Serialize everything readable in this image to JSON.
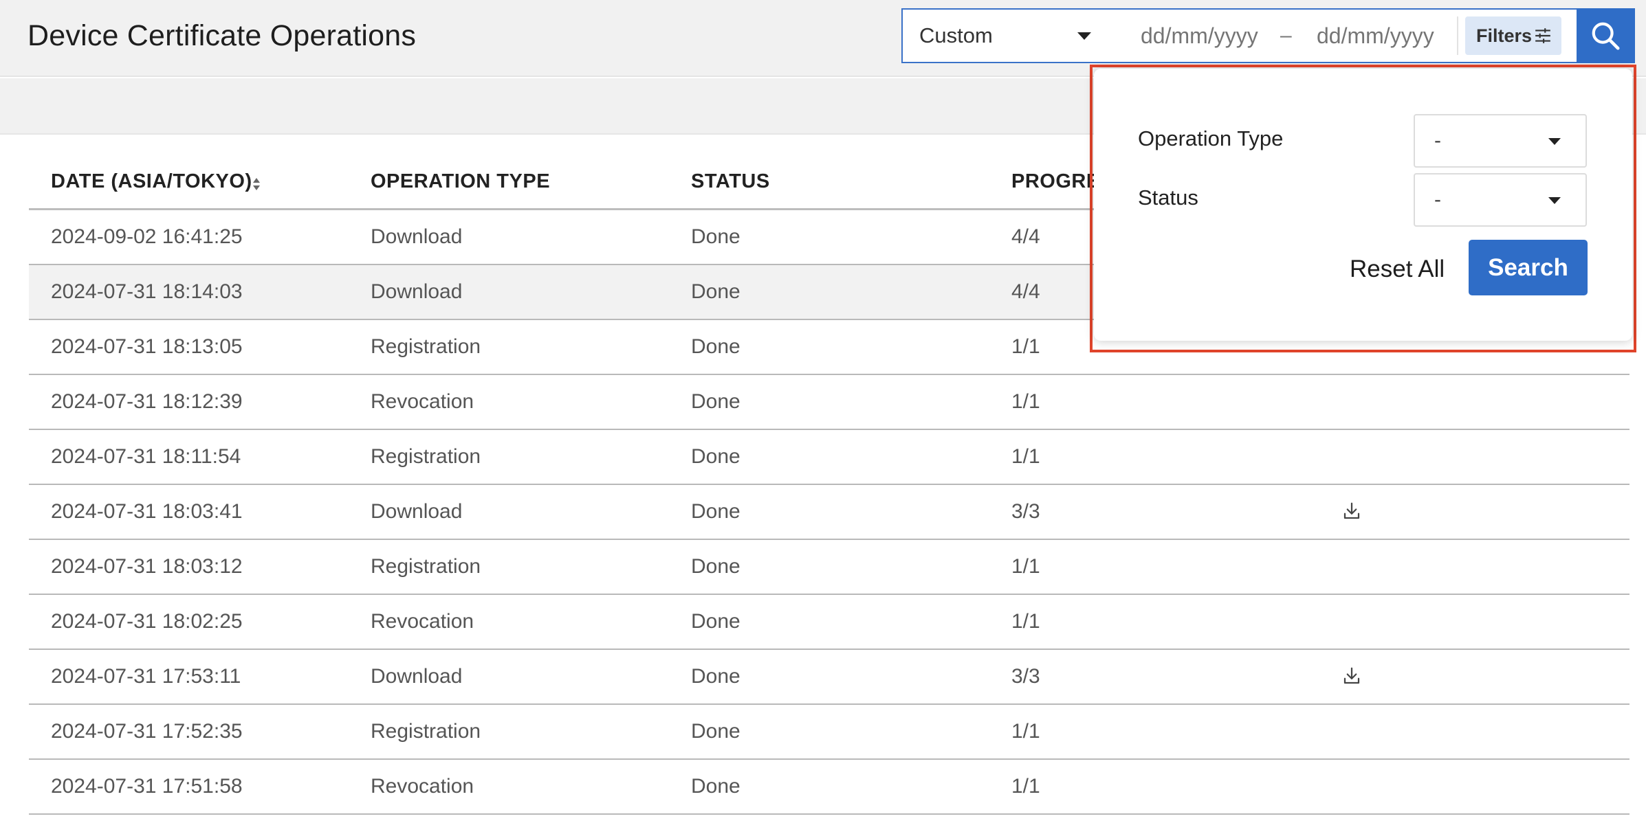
{
  "header": {
    "title": "Device Certificate Operations"
  },
  "filterbar": {
    "period": "Custom",
    "date_from_placeholder": "dd/mm/yyyy",
    "date_separator": "–",
    "date_to_placeholder": "dd/mm/yyyy",
    "filters_label": "Filters"
  },
  "table": {
    "columns": [
      "DATE (ASIA/TOKYO)",
      "OPERATION TYPE",
      "STATUS",
      "PROGRESS"
    ],
    "rows": [
      {
        "date": "2024-09-02 16:41:25",
        "type": "Download",
        "status": "Done",
        "progress": "4/4",
        "download": false
      },
      {
        "date": "2024-07-31 18:14:03",
        "type": "Download",
        "status": "Done",
        "progress": "4/4",
        "download": false
      },
      {
        "date": "2024-07-31 18:13:05",
        "type": "Registration",
        "status": "Done",
        "progress": "1/1",
        "download": false
      },
      {
        "date": "2024-07-31 18:12:39",
        "type": "Revocation",
        "status": "Done",
        "progress": "1/1",
        "download": false
      },
      {
        "date": "2024-07-31 18:11:54",
        "type": "Registration",
        "status": "Done",
        "progress": "1/1",
        "download": false
      },
      {
        "date": "2024-07-31 18:03:41",
        "type": "Download",
        "status": "Done",
        "progress": "3/3",
        "download": true
      },
      {
        "date": "2024-07-31 18:03:12",
        "type": "Registration",
        "status": "Done",
        "progress": "1/1",
        "download": false
      },
      {
        "date": "2024-07-31 18:02:25",
        "type": "Revocation",
        "status": "Done",
        "progress": "1/1",
        "download": false
      },
      {
        "date": "2024-07-31 17:53:11",
        "type": "Download",
        "status": "Done",
        "progress": "3/3",
        "download": true
      },
      {
        "date": "2024-07-31 17:52:35",
        "type": "Registration",
        "status": "Done",
        "progress": "1/1",
        "download": false
      },
      {
        "date": "2024-07-31 17:51:58",
        "type": "Revocation",
        "status": "Done",
        "progress": "1/1",
        "download": false
      }
    ]
  },
  "filter_popover": {
    "operation_type_label": "Operation Type",
    "operation_type_value": "-",
    "status_label": "Status",
    "status_value": "-",
    "reset_label": "Reset All",
    "search_label": "Search"
  },
  "icons": {
    "filters": "sliders-icon",
    "search": "search-icon",
    "sort": "sort-icon",
    "download": "download-icon"
  },
  "colors": {
    "accent": "#2f6dc7",
    "highlight_outline": "#e0442b"
  }
}
